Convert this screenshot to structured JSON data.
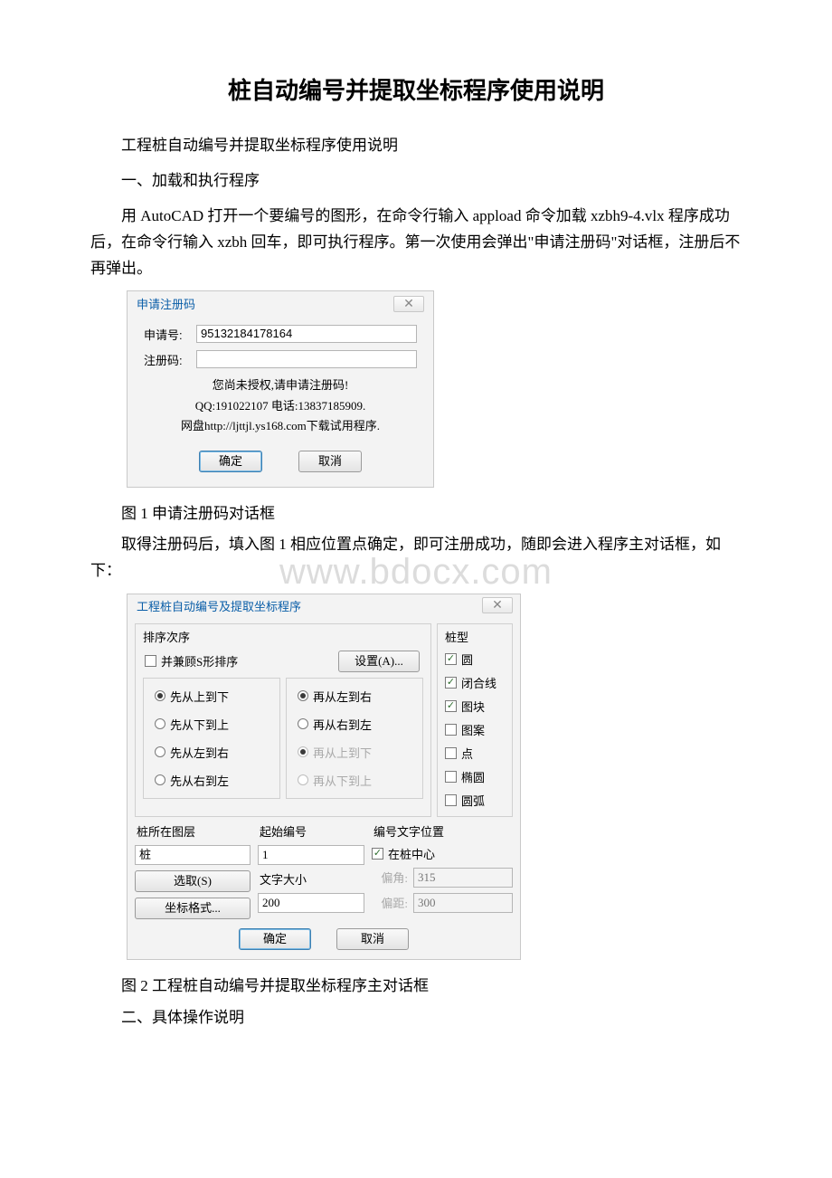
{
  "doc": {
    "title": "桩自动编号并提取坐标程序使用说明",
    "p1": "工程桩自动编号并提取坐标程序使用说明",
    "s1": "一、加载和执行程序",
    "p2": "用 AutoCAD 打开一个要编号的图形，在命令行输入 appload 命令加载 xzbh9-4.vlx 程序成功后，在命令行输入 xzbh 回车，即可执行程序。第一次使用会弹出\"申请注册码\"对话框，注册后不再弹出。",
    "cap1": "图 1 申请注册码对话框",
    "p3": "取得注册码后，填入图 1 相应位置点确定，即可注册成功，随即会进入程序主对话框，如下：",
    "cap2": "图 2 工程桩自动编号并提取坐标程序主对话框",
    "s2": "二、具体操作说明"
  },
  "watermark": "www.bdocx.com",
  "dlg1": {
    "title": "申请注册码",
    "close": "✕",
    "apply_label": "申请号:",
    "apply_value": "95132184178164",
    "reg_label": "注册码:",
    "reg_value": "",
    "msg1": "您尚未授权,请申请注册码!",
    "msg2": "QQ:191022107     电话:13837185909.",
    "msg3": "网盘http://ljttjl.ys168.com下载试用程序.",
    "ok": "确定",
    "cancel": "取消"
  },
  "dlg2": {
    "title": "工程桩自动编号及提取坐标程序",
    "close": "✕",
    "sort_legend": "排序次序",
    "s_check": "并兼顾S形排序",
    "settings_btn": "设置(A)...",
    "col1": {
      "r1": "先从上到下",
      "r2": "先从下到上",
      "r3": "先从左到右",
      "r4": "先从右到左"
    },
    "col2": {
      "r1": "再从左到右",
      "r2": "再从右到左",
      "r3": "再从上到下",
      "r4": "再从下到上"
    },
    "type_legend": "桩型",
    "types": {
      "t1": "圆",
      "t2": "闭合线",
      "t3": "图块",
      "t4": "图案",
      "t5": "点",
      "t6": "椭圆",
      "t7": "圆弧"
    },
    "layer_label": "桩所在图层",
    "layer_value": "桩",
    "select_btn": "选取(S)",
    "coord_btn": "坐标格式...",
    "startnum_label": "起始编号",
    "startnum_value": "1",
    "textsize_label": "文字大小",
    "textsize_value": "200",
    "pos_label": "编号文字位置",
    "center_check": "在桩中心",
    "angle_label": "偏角:",
    "angle_value": "315",
    "dist_label": "偏距:",
    "dist_value": "300",
    "ok": "确定",
    "cancel": "取消"
  }
}
